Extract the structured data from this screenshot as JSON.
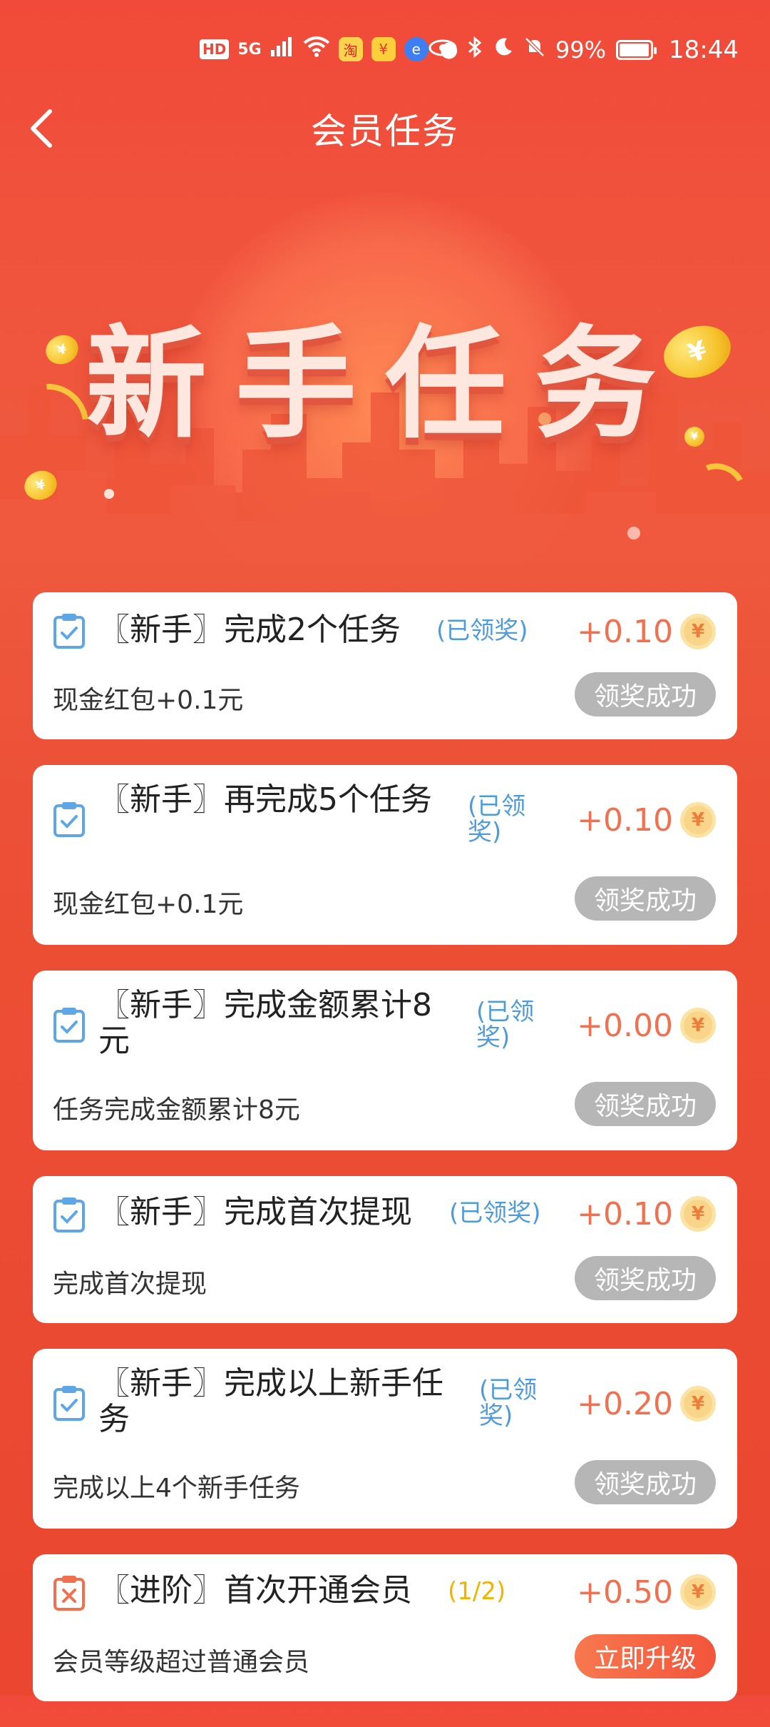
{
  "status_bar": {
    "network_badges": [
      "HD",
      "5G"
    ],
    "battery": "99%",
    "time": "18:44",
    "battery_level": 0.99
  },
  "header": {
    "title": "会员任务",
    "back_icon": "chevron-left-icon"
  },
  "banner": {
    "title": "新手任务"
  },
  "tasks": [
    {
      "title": "〖新手〗完成2个任务",
      "status": "(已领奖)",
      "reward": "+0.10",
      "desc": "现金红包+0.1元",
      "button": "领奖成功",
      "icon": "clipboard-check-icon"
    },
    {
      "title": "〖新手〗再完成5个任务",
      "status": "(已领奖)",
      "reward": "+0.10",
      "desc": "现金红包+0.1元",
      "button": "领奖成功",
      "icon": "clipboard-check-icon"
    },
    {
      "title": "〖新手〗完成金额累计8元",
      "status": "(已领奖)",
      "reward": "+0.00",
      "desc": "任务完成金额累计8元",
      "button": "领奖成功",
      "icon": "clipboard-check-icon"
    },
    {
      "title": "〖新手〗完成首次提现",
      "status": "(已领奖)",
      "reward": "+0.10",
      "desc": "完成首次提现",
      "button": "领奖成功",
      "icon": "clipboard-check-icon"
    },
    {
      "title": "〖新手〗完成以上新手任务",
      "status": "(已领奖)",
      "reward": "+0.20",
      "desc": "完成以上4个新手任务",
      "button": "领奖成功",
      "icon": "clipboard-check-icon"
    },
    {
      "title": "〖进阶〗首次开通会员",
      "status": "(1/2)",
      "reward": "+0.50",
      "desc": "会员等级超过普通会员",
      "button": "立即升级",
      "icon": "clipboard-x-icon"
    }
  ],
  "colors": {
    "accent": "#f0704f",
    "status_done": "#4e9bdc",
    "status_progress": "#f0b400",
    "button_done": "#b6b6b6",
    "button_active": "#f3553b"
  },
  "coin_symbol": "¥"
}
